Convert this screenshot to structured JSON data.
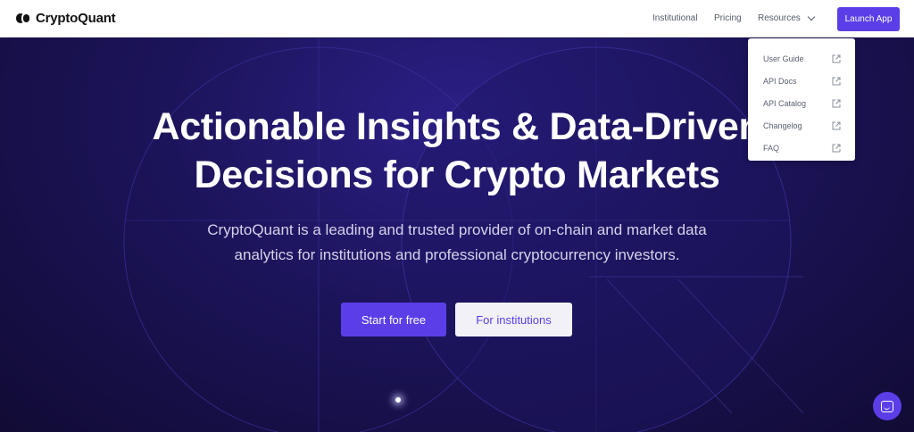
{
  "header": {
    "brand": "CryptoQuant",
    "nav": {
      "institutional": "Institutional",
      "pricing": "Pricing",
      "resources": "Resources"
    },
    "launch_label": "Launch App"
  },
  "resources_menu": {
    "items": [
      {
        "label": "User Guide",
        "icon": "external-link-icon"
      },
      {
        "label": "API Docs",
        "icon": "external-link-icon"
      },
      {
        "label": "API Catalog",
        "icon": "external-link-icon"
      },
      {
        "label": "Changelog",
        "icon": "external-link-icon"
      },
      {
        "label": "FAQ",
        "icon": "external-link-icon"
      }
    ]
  },
  "hero": {
    "headline_line1": "Actionable Insights & Data-Driven",
    "headline_line2": "Decisions for Crypto Markets",
    "subtext_line1": "CryptoQuant is a leading and trusted provider of on-chain and market data",
    "subtext_line2": "analytics for institutions and professional cryptocurrency investors.",
    "primary_cta": "Start for free",
    "secondary_cta": "For institutions"
  },
  "chat": {
    "icon": "chat-icon"
  },
  "colors": {
    "accent": "#5b3ee8",
    "hero_bg": "#1c145a",
    "header_bg": "#ffffff"
  }
}
